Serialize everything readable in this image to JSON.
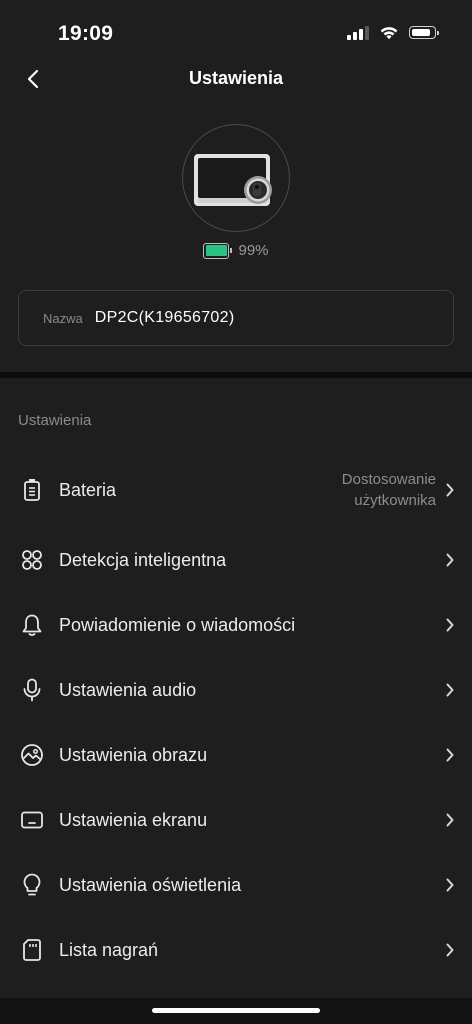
{
  "status_bar": {
    "time": "19:09"
  },
  "nav": {
    "title": "Ustawienia"
  },
  "device": {
    "battery_percent_text": "99%",
    "battery_level": 0.99
  },
  "name_field": {
    "label": "Nazwa",
    "value": "DP2C(K19656702)"
  },
  "settings": {
    "section_title": "Ustawienia",
    "items": [
      {
        "label": "Bateria",
        "icon": "battery-icon",
        "value_line1": "Dostosowanie",
        "value_line2": "użytkownika"
      },
      {
        "label": "Detekcja inteligentna",
        "icon": "smart-detection-icon"
      },
      {
        "label": "Powiadomienie o wiadomości",
        "icon": "bell-icon"
      },
      {
        "label": "Ustawienia audio",
        "icon": "microphone-icon"
      },
      {
        "label": "Ustawienia obrazu",
        "icon": "image-icon"
      },
      {
        "label": "Ustawienia ekranu",
        "icon": "screen-icon"
      },
      {
        "label": "Ustawienia oświetlenia",
        "icon": "lightbulb-icon"
      },
      {
        "label": "Lista nagrań",
        "icon": "sd-card-icon"
      }
    ]
  },
  "colors": {
    "background": "#1e1e1e",
    "accent_battery": "#2cc286",
    "text_secondary": "#8c8c8c"
  }
}
